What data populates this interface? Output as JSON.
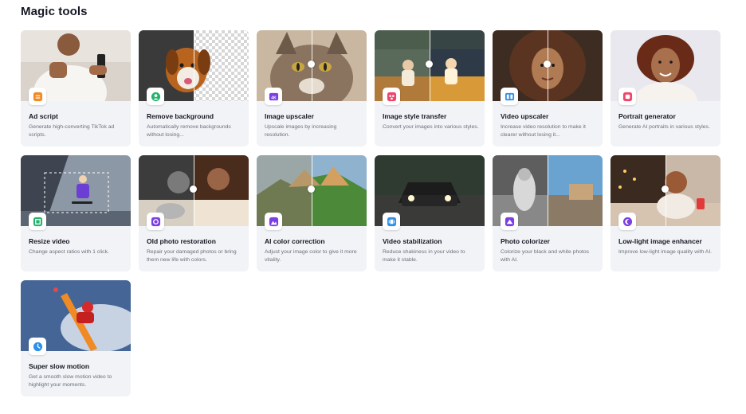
{
  "section": {
    "title": "Magic tools"
  },
  "tools": [
    {
      "title": "Ad script",
      "desc": "Generate high-converting TikTok ad scripts.",
      "icon": "document-icon",
      "color": "#f08a24"
    },
    {
      "title": "Remove background",
      "desc": "Automatically remove backgrounds without losing...",
      "icon": "person-cutout-icon",
      "color": "#25b36b"
    },
    {
      "title": "Image upscaler",
      "desc": "Upscale images by increasing resolution.",
      "icon": "hd-image-icon",
      "color": "#7b3fe4"
    },
    {
      "title": "Image style transfer",
      "desc": "Convert your images into various styles.",
      "icon": "palette-icon",
      "color": "#f0456b"
    },
    {
      "title": "Video upscaler",
      "desc": "Increase video resolution to make it clearer without losing it...",
      "icon": "video-hd-icon",
      "color": "#2f8fe8"
    },
    {
      "title": "Portrait generator",
      "desc": "Generate AI portraits in various styles.",
      "icon": "portrait-icon",
      "color": "#f0456b"
    },
    {
      "title": "Resize video",
      "desc": "Change aspect ratios with 1 click.",
      "icon": "resize-icon",
      "color": "#25b36b"
    },
    {
      "title": "Old photo restoration",
      "desc": "Repair your damaged photos or bring them new life with colors.",
      "icon": "restore-photo-icon",
      "color": "#7b3fe4"
    },
    {
      "title": "AI color correction",
      "desc": "Adjust your image color to give it more vitality.",
      "icon": "color-correction-icon",
      "color": "#7b3fe4"
    },
    {
      "title": "Video stabilization",
      "desc": "Reduce shakiness in your video to make it stable.",
      "icon": "stabilize-icon",
      "color": "#2f8fe8"
    },
    {
      "title": "Photo colorizer",
      "desc": "Colorize your black and white photos with AI.",
      "icon": "colorize-icon",
      "color": "#7b3fe4"
    },
    {
      "title": "Low-light image enhancer",
      "desc": "Improve low-light image quality with AI.",
      "icon": "moon-icon",
      "color": "#7b3fe4"
    },
    {
      "title": "Super slow motion",
      "desc": "Get a smooth slow motion video to highlight your moments.",
      "icon": "slow-motion-icon",
      "color": "#2f8fe8"
    }
  ]
}
